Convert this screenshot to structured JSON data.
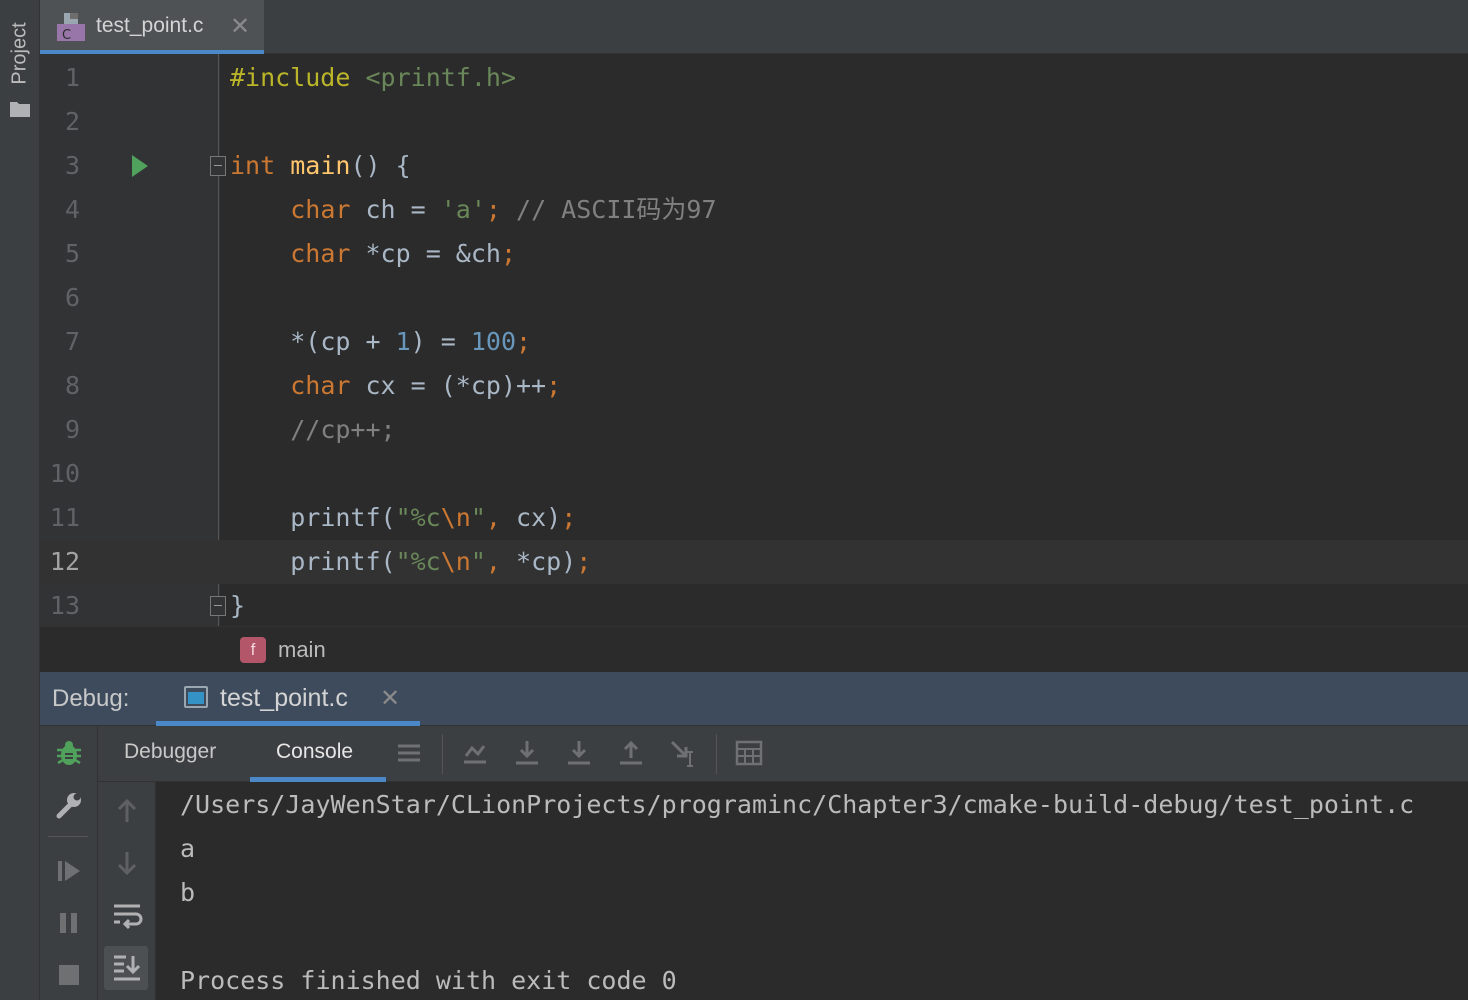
{
  "sidebar": {
    "project_label": "Project"
  },
  "editor_tab": {
    "title": "test_point.c",
    "close": "✕",
    "file_icon_letter": "C"
  },
  "code": {
    "line_numbers": [
      "1",
      "2",
      "3",
      "4",
      "5",
      "6",
      "7",
      "8",
      "9",
      "10",
      "11",
      "12",
      "13"
    ],
    "current_line": "12",
    "l1": {
      "directive": "#include",
      "header": "<printf.h>"
    },
    "l3": {
      "type": "int",
      "func": "main",
      "rest": "() {"
    },
    "l4": {
      "type": "char",
      "mid": " ch = ",
      "char_lit": "'a'",
      "semi": ";",
      "comment": " // ASCII码为97"
    },
    "l5": {
      "type": "char",
      "mid": " *cp = &ch",
      "semi": ";"
    },
    "l7": {
      "a": "*(cp + ",
      "n1": "1",
      "b": ") = ",
      "n2": "100",
      "semi": ";"
    },
    "l8": {
      "type": "char",
      "mid": " cx = (*cp)++",
      "semi": ";"
    },
    "l9": {
      "comment": "//cp++;"
    },
    "l11": {
      "fn": "printf(",
      "s1": "\"%c",
      "esc": "\\n",
      "s2": "\"",
      "comma": ",",
      "arg": " cx)",
      "semi": ";"
    },
    "l12": {
      "fn": "printf(",
      "s1": "\"%c",
      "esc": "\\n",
      "s2": "\"",
      "comma": ",",
      "arg": " *cp)",
      "semi": ";"
    },
    "l13": {
      "brace": "}"
    }
  },
  "breadcrumb": {
    "badge": "f",
    "function": "main"
  },
  "debug": {
    "label": "Debug:",
    "tab_title": "test_point.c",
    "close": "✕",
    "subtabs": {
      "debugger": "Debugger",
      "console": "Console"
    }
  },
  "console": {
    "lines": [
      "/Users/JayWenStar/CLionProjects/programinc/Chapter3/cmake-build-debug/test_point.c",
      "a",
      "b",
      "",
      "Process finished with exit code 0"
    ]
  },
  "colors": {
    "keyword": "#cc7832",
    "string": "#6a8759",
    "number": "#6897bb",
    "comment": "#808080",
    "function": "#ffc66d",
    "accent": "#4a88c7",
    "run": "#4fa15b"
  }
}
